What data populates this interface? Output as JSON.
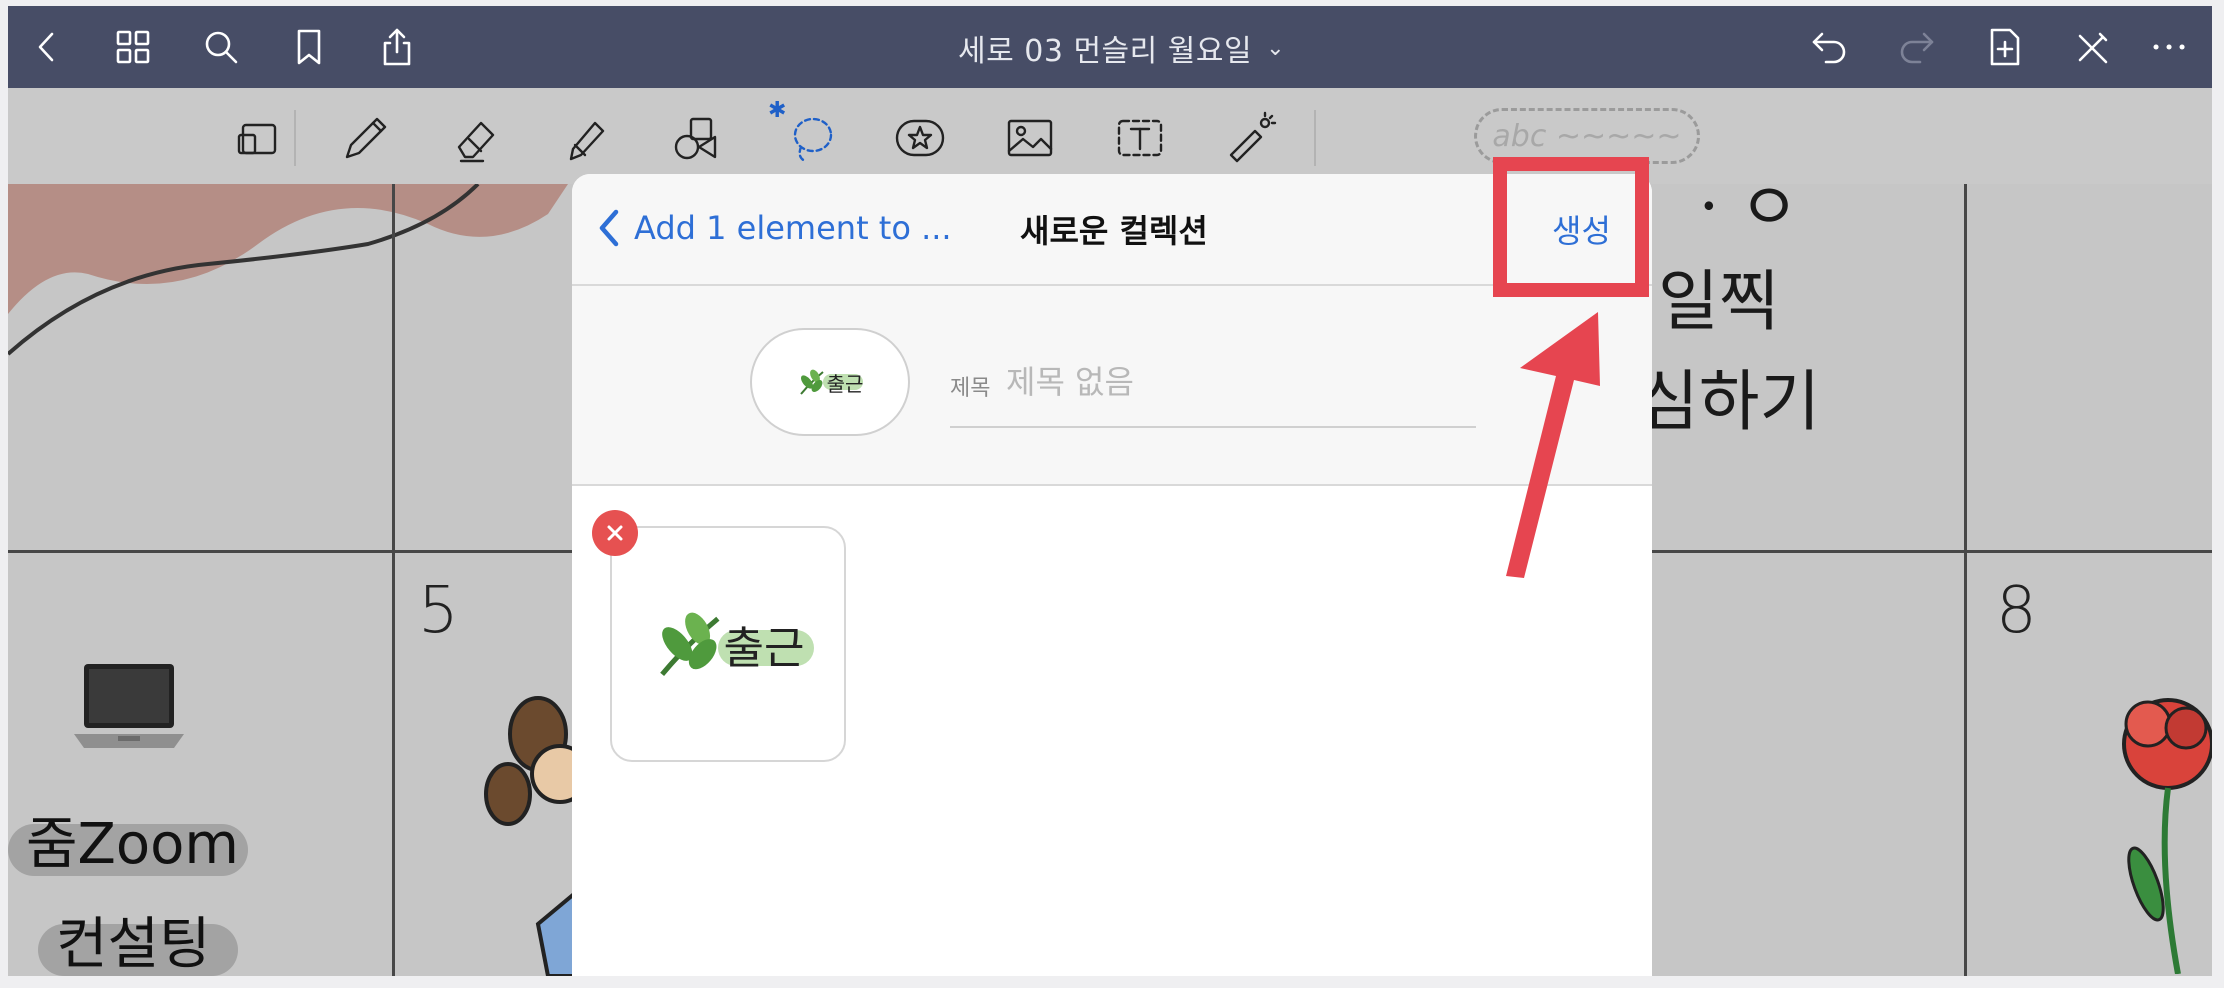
{
  "topbar": {
    "document_title": "세로 03 먼슬리 월요일",
    "icons": [
      "back-icon",
      "grid-icon",
      "search-icon",
      "bookmark-icon",
      "share-icon",
      "undo-icon",
      "redo-icon",
      "add-page-icon",
      "pen-off-icon",
      "more-icon"
    ]
  },
  "toolbar": {
    "tape_placeholder": "abc ~~~~~",
    "tools": [
      "zoom-window-icon",
      "pen-icon",
      "eraser-icon",
      "highlighter-icon",
      "shapes-icon",
      "lasso-icon",
      "elements-icon",
      "image-icon",
      "text-icon",
      "laser-pointer-icon"
    ],
    "bluetooth_mark": "✱"
  },
  "planner": {
    "day_numbers": [
      "5",
      "8"
    ],
    "right_notes": [
      "ㆍㅇ",
      "일찍",
      "심하기"
    ],
    "left_note_line1": "줌Zoom",
    "left_note_line2": "컨설팅"
  },
  "sheet": {
    "back_label": "Add 1 element to ...",
    "title": "새로운 컬렉션",
    "create_label": "생성",
    "title_field_label": "제목",
    "title_field_placeholder": "제목 없음",
    "title_field_value": "",
    "element_text": "출근",
    "cover_text": "출근"
  },
  "colors": {
    "topbar_bg": "#474d66",
    "accent_blue": "#2e6fd6",
    "highlight_red": "#e64550",
    "remove_red": "#e65151"
  }
}
